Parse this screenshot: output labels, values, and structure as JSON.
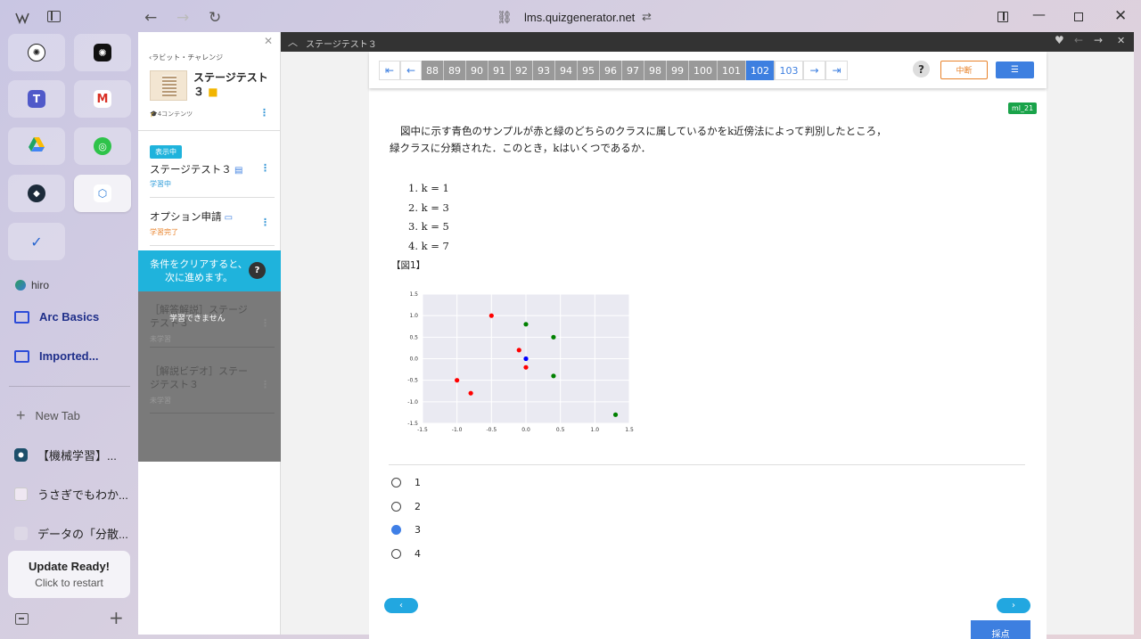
{
  "browser": {
    "url": "lms.quizgenerator.net",
    "profile": "hiro",
    "folders": [
      "Arc Basics",
      "Imported..."
    ],
    "new_tab": "New Tab",
    "tabs": [
      "【機械学習】...",
      "うさぎでもわか...",
      "データの「分散..."
    ],
    "update_title": "Update Ready!",
    "update_sub": "Click to restart"
  },
  "outline": {
    "breadcrumb": "‹ラビット・チャレンジ",
    "course_title": "ステージテスト３",
    "contents_count": "4コンテンツ",
    "showing_badge": "表示中",
    "items": [
      {
        "title": "ステージテスト３",
        "status": "学習中",
        "status_color": "#2a9ad8"
      },
      {
        "title": "オプション申請",
        "status": "学習完了",
        "status_color": "#e8822a"
      },
      {
        "title": "［解答解説］ステージテスト３",
        "status": "未学習",
        "status_color": "#999"
      },
      {
        "title": "［解説ビデオ］ステージテスト３",
        "status": "未学習",
        "status_color": "#999"
      }
    ],
    "lock_notice": "条件をクリアすると、次に進めます。",
    "lock_line1": "条件をクリアすると、",
    "lock_line2": "次に進めます。",
    "cannot_study": "学習できません",
    "help": "?"
  },
  "viewer": {
    "title": "ステージテスト３",
    "pages": [
      "88",
      "89",
      "90",
      "91",
      "92",
      "93",
      "94",
      "95",
      "96",
      "97",
      "98",
      "99",
      "100",
      "101",
      "102",
      "103"
    ],
    "current_page": "102",
    "pause_label": "中断",
    "help": "?",
    "tag": "ml_21",
    "question_line1": "図中に示す青色のサンプルが赤と緑のどちらのクラスに属しているかをk近傍法によって判別したところ，",
    "question_line2": "緑クラスに分類された．このとき，kはいくつであるか．",
    "choices_text": [
      "1.  k = 1",
      "2.  k = 3",
      "3.  k = 5",
      "4.  k = 7"
    ],
    "figure_label": "【図1】",
    "answers": [
      "1",
      "2",
      "3",
      "4"
    ],
    "selected_answer": "3",
    "submit_label": "採点"
  },
  "chart_data": {
    "type": "scatter",
    "xlim": [
      -1.5,
      1.5
    ],
    "ylim": [
      -1.5,
      1.5
    ],
    "xticks": [
      "-1.5",
      "-1.0",
      "-0.5",
      "0.0",
      "0.5",
      "1.0",
      "1.5"
    ],
    "yticks": [
      "1.5",
      "1.0",
      "0.5",
      "0.0",
      "-0.5",
      "-1.0",
      "-1.5"
    ],
    "grid": true,
    "series": [
      {
        "color": "#ff0000",
        "points": [
          [
            -0.5,
            1.0
          ],
          [
            -0.1,
            0.2
          ],
          [
            0.0,
            -0.2
          ],
          [
            -1.0,
            -0.5
          ],
          [
            -0.8,
            -0.8
          ]
        ]
      },
      {
        "color": "#008000",
        "points": [
          [
            0.0,
            0.8
          ],
          [
            0.4,
            0.5
          ],
          [
            0.4,
            -0.4
          ],
          [
            1.3,
            -1.3
          ]
        ]
      },
      {
        "color": "#0000ff",
        "points": [
          [
            0.0,
            0.0
          ]
        ]
      }
    ]
  }
}
